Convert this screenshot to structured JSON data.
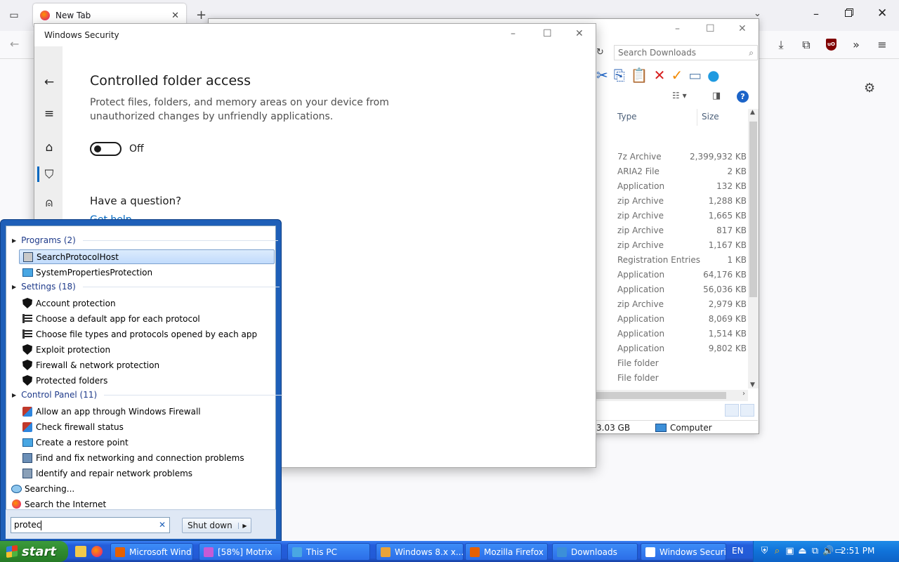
{
  "firefox": {
    "tab_title": "New Tab"
  },
  "explorer": {
    "search_placeholder": "Search Downloads",
    "col_type": "Type",
    "col_size": "Size",
    "rows": [
      {
        "type": "7z Archive",
        "size": "2,399,932 KB"
      },
      {
        "type": "ARIA2 File",
        "size": "2 KB"
      },
      {
        "type": "Application",
        "size": "132 KB"
      },
      {
        "type": "zip Archive",
        "size": "1,288 KB"
      },
      {
        "type": "zip Archive",
        "size": "1,665 KB"
      },
      {
        "type": "zip Archive",
        "size": "817 KB"
      },
      {
        "type": "zip Archive",
        "size": "1,167 KB"
      },
      {
        "type": "Registration Entries",
        "size": "1 KB"
      },
      {
        "type": "Application",
        "size": "64,176 KB"
      },
      {
        "type": "Application",
        "size": "56,036 KB"
      },
      {
        "type": "zip Archive",
        "size": "2,979 KB"
      },
      {
        "type": "Application",
        "size": "8,069 KB"
      },
      {
        "type": "Application",
        "size": "1,514 KB"
      },
      {
        "type": "Application",
        "size": "9,802 KB"
      },
      {
        "type": "File folder",
        "size": ""
      },
      {
        "type": "File folder",
        "size": ""
      }
    ],
    "status_free": "3.03 GB",
    "status_location": "Computer"
  },
  "winsec": {
    "title": "Windows Security",
    "heading": "Controlled folder access",
    "description": "Protect files, folders, and memory areas on your device from unauthorized changes by unfriendly applications.",
    "toggle_state": "Off",
    "question": "Have a question?",
    "help_link": "Get help"
  },
  "startmenu": {
    "groups": {
      "programs": "Programs (2)",
      "settings": "Settings (18)",
      "control_panel": "Control Panel (11)"
    },
    "programs": [
      "SearchProtocolHost",
      "SystemPropertiesProtection"
    ],
    "settings": [
      "Account protection",
      "Choose a default app for each protocol",
      "Choose file types and protocols opened by each app",
      "Exploit protection",
      "Firewall & network protection",
      "Protected folders"
    ],
    "control_panel": [
      "Allow an app through Windows Firewall",
      "Check firewall status",
      "Create a restore point",
      "Find and fix networking and connection problems",
      "Identify and repair network problems"
    ],
    "searching": "Searching...",
    "search_internet": "Search the Internet",
    "search_value": "protec",
    "shutdown_label": "Shut down"
  },
  "taskbar": {
    "start_label": "start",
    "tasks": [
      {
        "label": "Microsoft Wind...",
        "color": "#e66000"
      },
      {
        "label": "[58%] Motrix",
        "color": "#c65bd6"
      },
      {
        "label": "This PC",
        "color": "#49a7e3"
      },
      {
        "label": "Windows 8.x x...",
        "color": "#e8a33a"
      },
      {
        "label": "Mozilla Firefox",
        "color": "#e66000"
      },
      {
        "label": "Downloads",
        "color": "#3c8fd8"
      },
      {
        "label": "Windows Security",
        "color": "#ffffff"
      }
    ],
    "language": "EN",
    "clock": "2:51 PM"
  }
}
